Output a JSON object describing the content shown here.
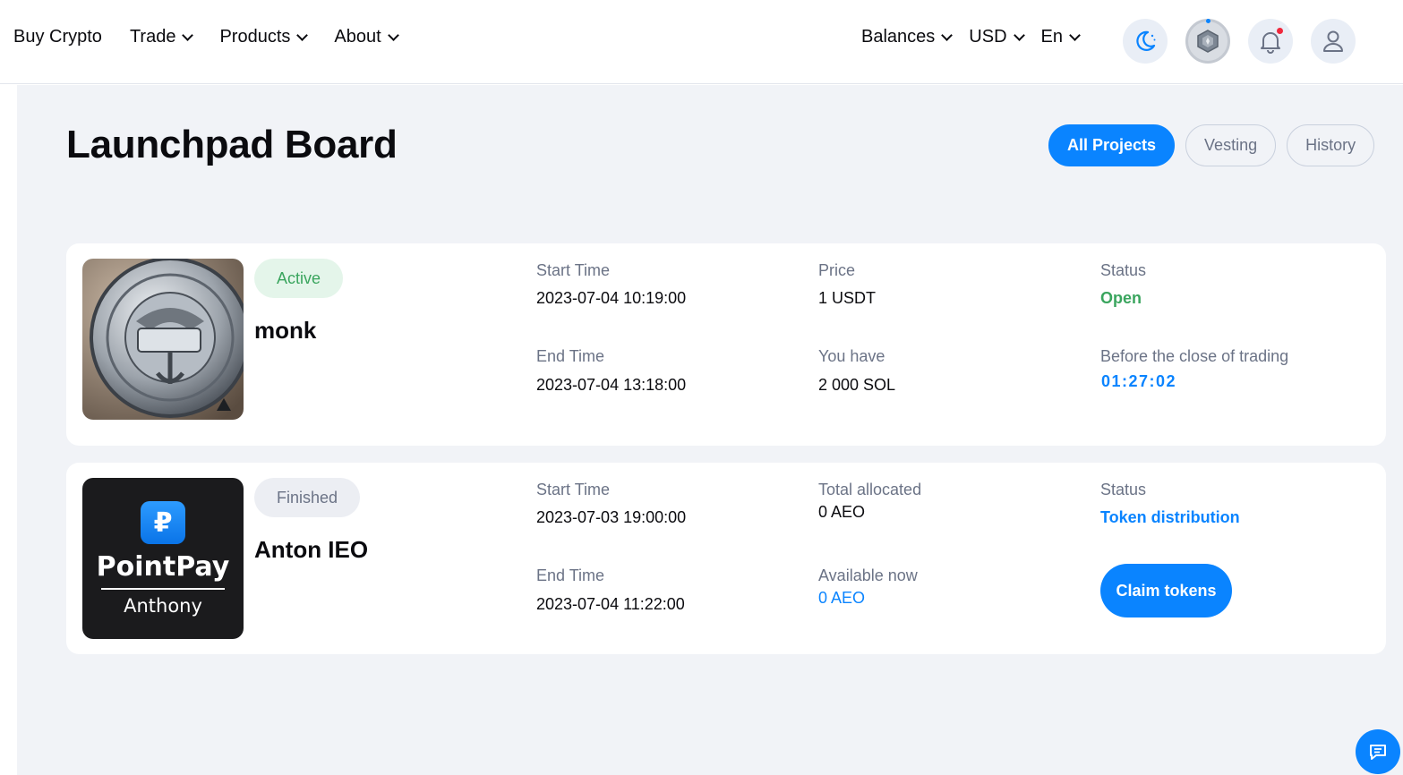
{
  "header": {
    "nav": {
      "buy_crypto": "Buy Crypto",
      "trade": "Trade",
      "products": "Products",
      "about": "About"
    },
    "right": {
      "balances": "Balances",
      "currency": "USD",
      "language": "En"
    },
    "icons": [
      "moon-icon",
      "rank-badge-icon",
      "bell-icon",
      "user-icon"
    ]
  },
  "page": {
    "title": "Launchpad Board",
    "tabs": [
      {
        "label": "All Projects",
        "active": true
      },
      {
        "label": "Vesting",
        "active": false
      },
      {
        "label": "History",
        "active": false
      }
    ]
  },
  "projects": [
    {
      "status_badge": "Active",
      "name": "monk",
      "start_time_label": "Start Time",
      "start_time": "2023-07-04 10:19:00",
      "end_time_label": "End Time",
      "end_time": "2023-07-04 13:18:00",
      "col2_top_label": "Price",
      "col2_top_value": "1 USDT",
      "col2_bottom_label": "You have",
      "col2_bottom_value": "2 000 SOL",
      "status_label": "Status",
      "status_value": "Open",
      "countdown_label": "Before the close of trading",
      "countdown": "01:27:02"
    },
    {
      "status_badge": "Finished",
      "name": "Anton IEO",
      "logo_text_main": "PointPay",
      "logo_text_sub": "Anthony",
      "start_time_label": "Start Time",
      "start_time": "2023-07-03 19:00:00",
      "end_time_label": "End Time",
      "end_time": "2023-07-04 11:22:00",
      "col2_top_label": "Total allocated",
      "col2_top_value": "0 AEO",
      "col2_bottom_label": "Available now",
      "col2_bottom_value": "0 AEO",
      "status_label": "Status",
      "status_value": "Token distribution",
      "claim_button": "Claim tokens"
    }
  ],
  "colors": {
    "accent": "#0a84ff",
    "active_green": "#3aa55e",
    "page_bg": "#f1f3f7"
  }
}
